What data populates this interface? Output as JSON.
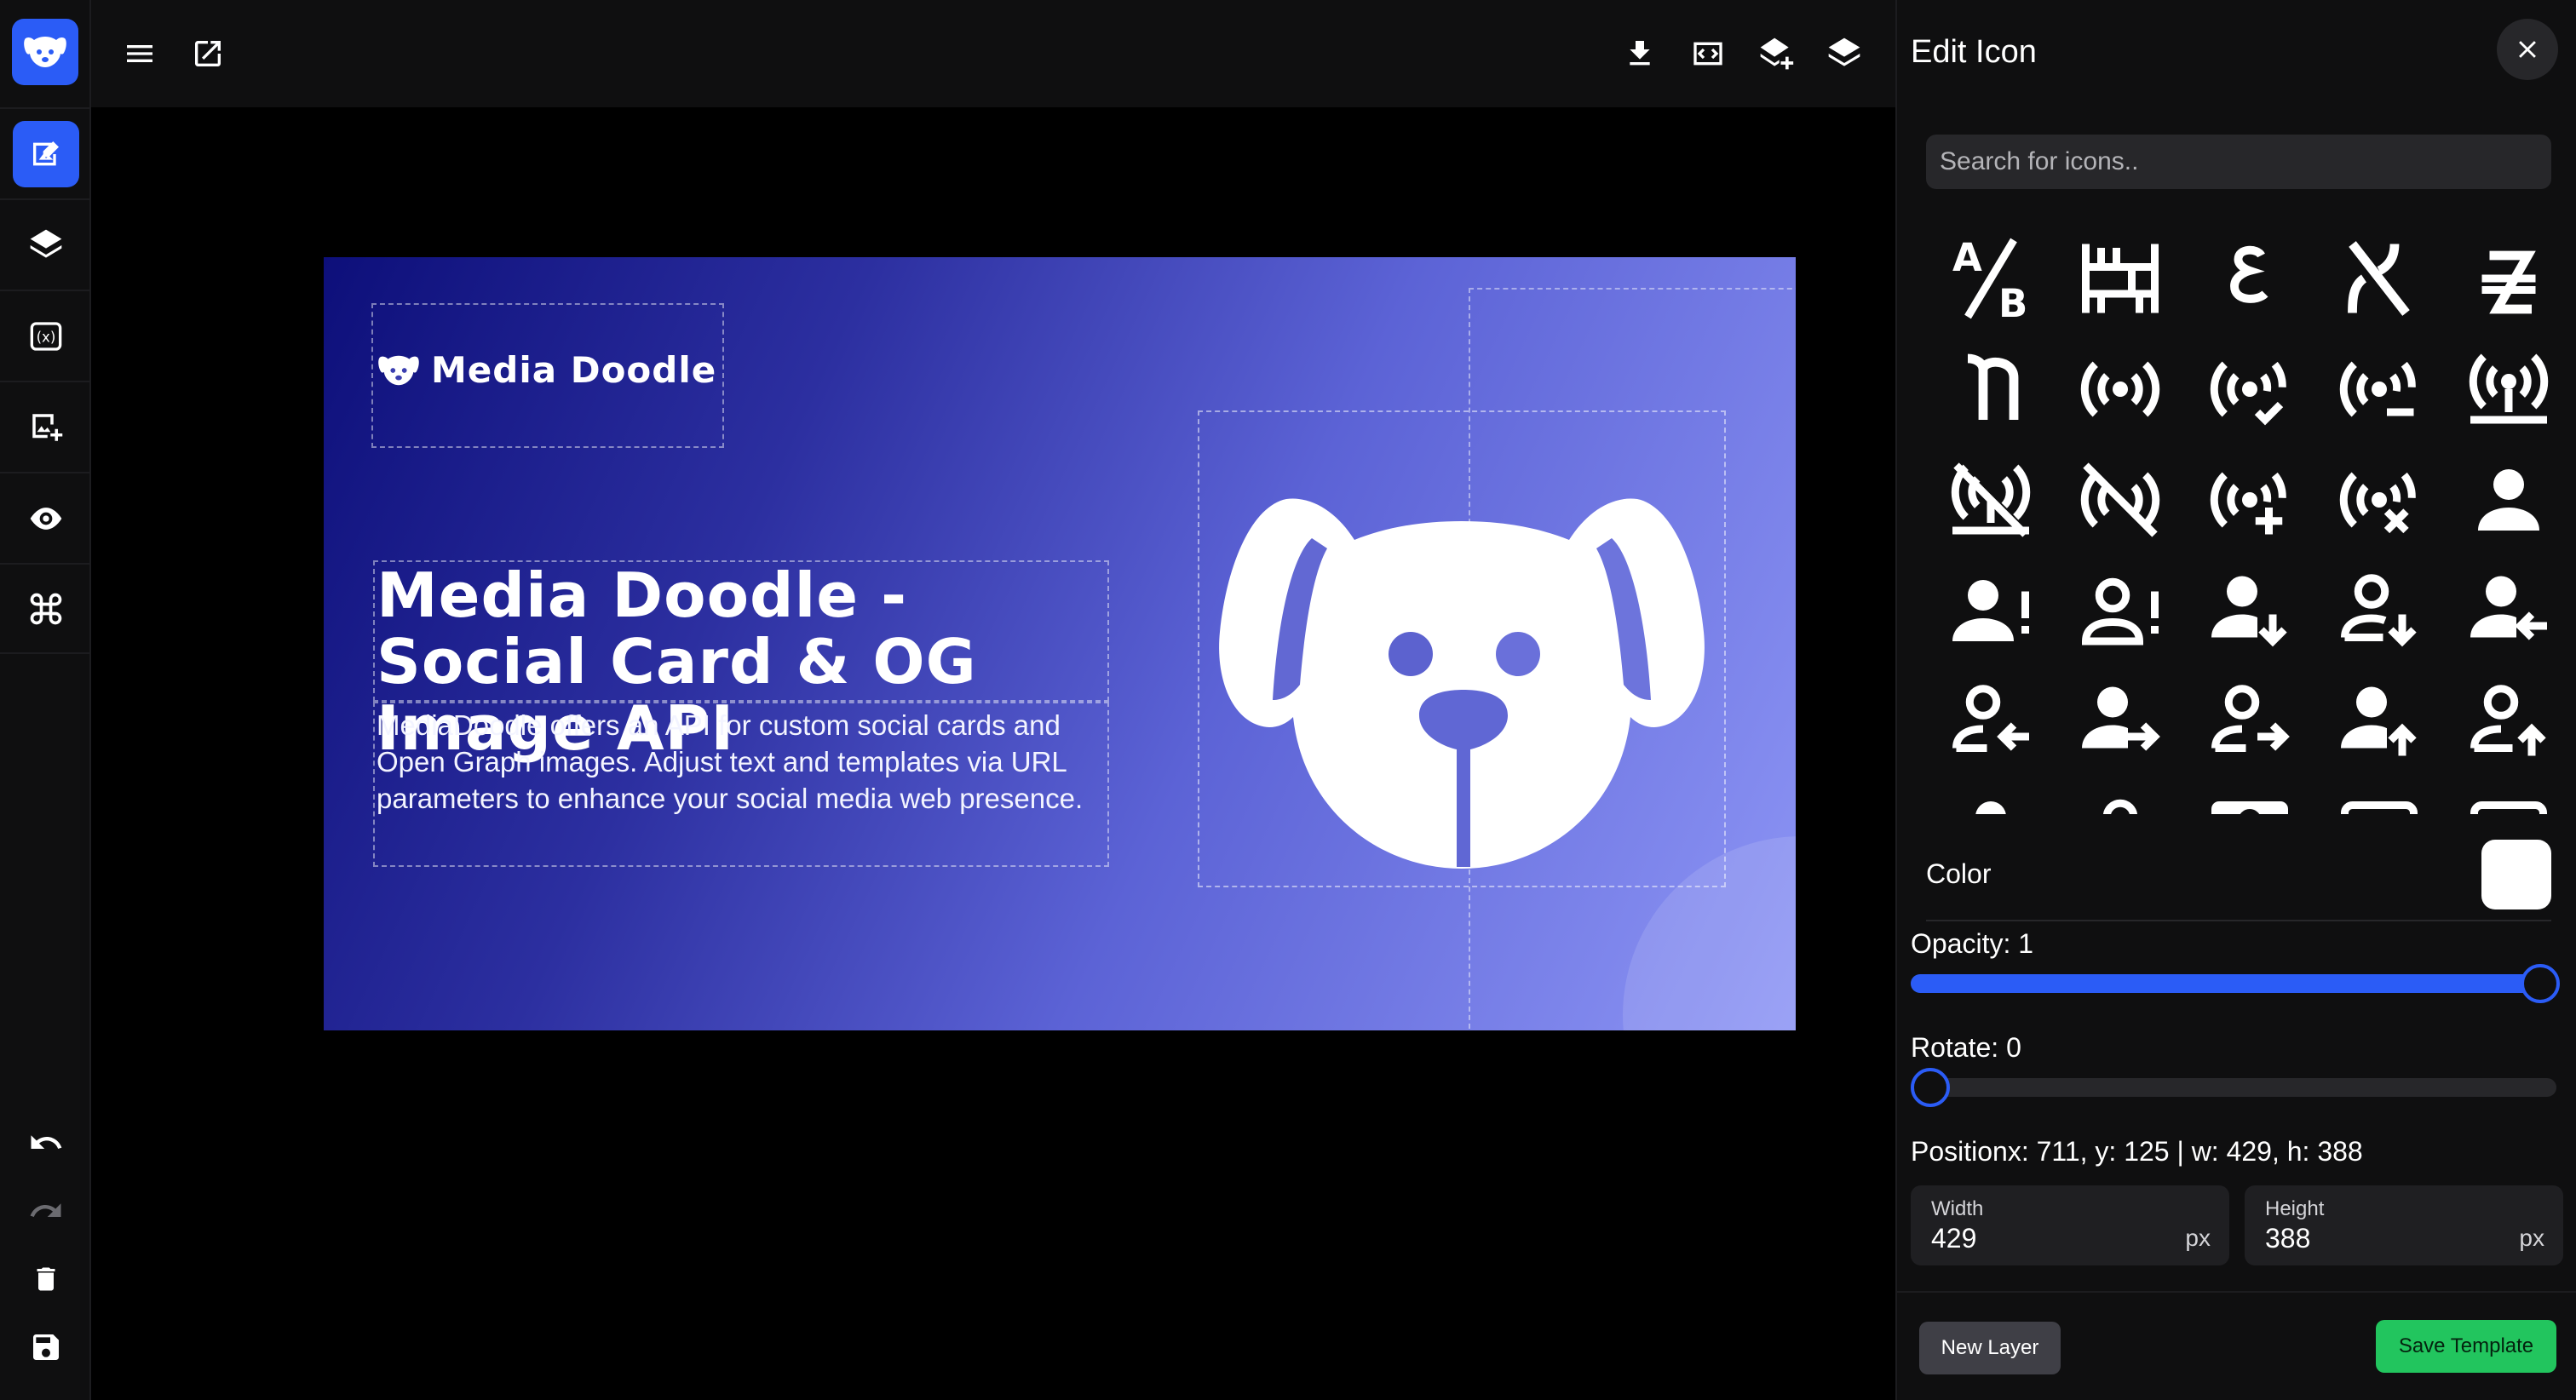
{
  "app": {
    "accent": "#2b5cf6",
    "save_color": "#22c55e"
  },
  "left_rail": {
    "logo_icon": "puppy-logo-icon",
    "tools": [
      "edit-image-icon",
      "layers-icon",
      "variables-icon",
      "add-image-icon",
      "eye-icon",
      "command-icon"
    ],
    "bottom": [
      "undo-icon",
      "redo-icon",
      "trash-icon",
      "save-icon"
    ]
  },
  "topbar": {
    "left": [
      "menu-icon",
      "open-external-icon"
    ],
    "right": [
      "download-icon",
      "embed-icon",
      "layer-plus-icon",
      "layer-stack-icon"
    ]
  },
  "canvas": {
    "brand_name": "Media Doodle",
    "headline": "Media Doodle - Social Card & OG Image API",
    "description": "MediaDoodle offers an API for custom social cards and Open Graph images. Adjust text and templates via URL parameters to enhance your social media web presence."
  },
  "panel": {
    "title": "Edit Icon",
    "search_placeholder": "Search for icons..",
    "icons": [
      "a-over-b-icon",
      "abacus-icon",
      "abugida-icon",
      "alef-icon",
      "austral-icon",
      "ayin-icon",
      "access-point-icon",
      "access-point-check-icon",
      "access-point-minus-icon",
      "access-point-network-icon",
      "access-point-network-off-icon",
      "access-point-off-icon",
      "access-point-plus-icon",
      "access-point-remove-icon",
      "account-icon",
      "account-alert-icon",
      "account-alert-outline-icon",
      "account-arrow-down-icon",
      "account-arrow-down-outline-icon",
      "account-arrow-left-icon",
      "account-arrow-left-outline-icon",
      "account-arrow-right-icon",
      "account-arrow-right-outline-icon",
      "account-arrow-up-icon",
      "account-arrow-up-outline-icon"
    ],
    "color_label": "Color",
    "color_value": "#ffffff",
    "opacity_label": "Opacity: 1",
    "opacity": 1,
    "rotate_label": "Rotate: 0",
    "rotate": 0,
    "position_text": "Positionx: 711, y: 125 | w: 429, h: 388",
    "width_label": "Width",
    "width_value": "429",
    "height_label": "Height",
    "height_value": "388",
    "unit": "px",
    "new_layer": "New Layer",
    "save_template": "Save Template"
  }
}
